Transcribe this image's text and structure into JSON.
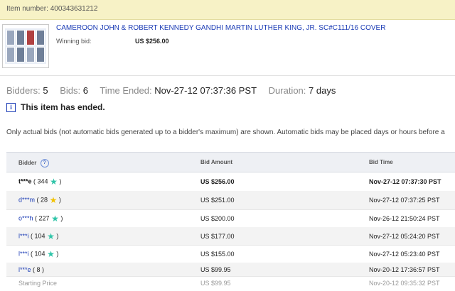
{
  "header": {
    "item_number": "Item number: 400343631212"
  },
  "item": {
    "title": "CAMEROON JOHN & ROBERT KENNEDY GANDHI MARTIN LUTHER KING, JR. SC#C111/16 COVER",
    "winning_bid_label": "Winning bid:",
    "winning_bid_value": "US $256.00"
  },
  "summary": {
    "bidders_label": "Bidders:",
    "bidders_value": "5",
    "bids_label": "Bids:",
    "bids_value": "6",
    "time_ended_label": "Time Ended:",
    "time_ended_value": "Nov-27-12 07:37:36 PST",
    "duration_label": "Duration:",
    "duration_value": "7 days"
  },
  "status": {
    "ended_text": "This item has ended.",
    "icon": "info-icon"
  },
  "note": "Only actual bids (not automatic bids generated up to a bidder's maximum) are shown. Automatic bids may be placed days or hours before a",
  "table": {
    "headers": {
      "bidder": "Bidder",
      "amount": "Bid Amount",
      "time": "Bid Time"
    },
    "rows": [
      {
        "name": "t***e",
        "feedback": "( 344",
        "close": ")",
        "star_color": "#2ec4a8",
        "amount": "US $256.00",
        "time": "Nov-27-12 07:37:30 PST"
      },
      {
        "name": "d***m",
        "feedback": "( 28",
        "close": ")",
        "star_color": "#f2c200",
        "amount": "US $251.00",
        "time": "Nov-27-12 07:37:25 PST"
      },
      {
        "name": "o***h",
        "feedback": "( 227",
        "close": ")",
        "star_color": "#2ec4a8",
        "amount": "US $200.00",
        "time": "Nov-26-12 21:50:24 PST"
      },
      {
        "name": "l***i",
        "feedback": "( 104",
        "close": ")",
        "star_color": "#2ec4a8",
        "amount": "US $177.00",
        "time": "Nov-27-12 05:24:20 PST"
      },
      {
        "name": "l***i",
        "feedback": "( 104",
        "close": ")",
        "star_color": "#2ec4a8",
        "amount": "US $155.00",
        "time": "Nov-27-12 05:23:40 PST"
      },
      {
        "name": "l***e",
        "feedback": "( 8 )",
        "amount": "US $99.95",
        "time": "Nov-20-12 17:36:57 PST"
      }
    ],
    "starting": {
      "label": "Starting Price",
      "amount": "US $99.95",
      "time": "Nov-20-12 09:35:32 PST"
    }
  }
}
